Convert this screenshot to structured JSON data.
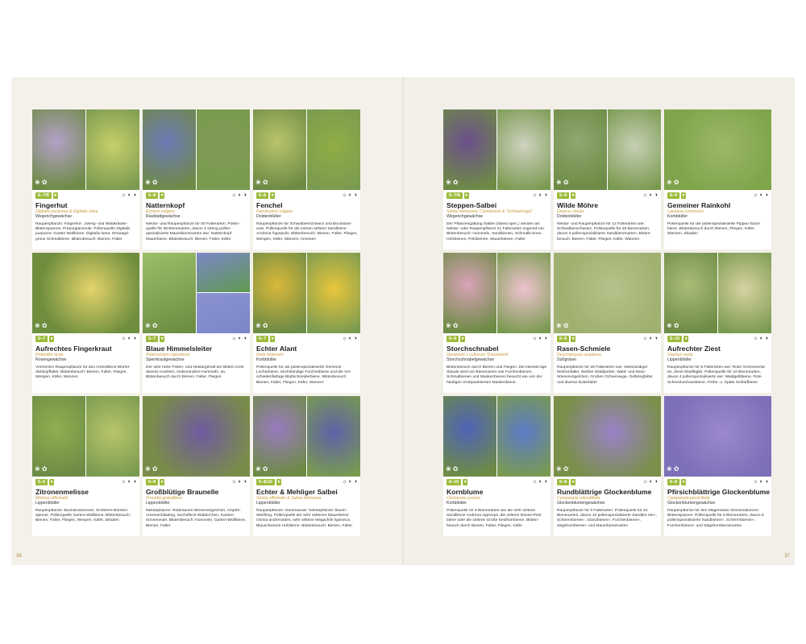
{
  "page_left_number": "36",
  "page_right_number": "37",
  "symbols": "☼ ◐ ◑",
  "left_cards": [
    {
      "months": "6–7/8",
      "name": "Fingerhut",
      "latin": "Digitalis purpurea & Digitalis lutea",
      "family": "Wegerichgewächse",
      "desc": "Raupenpflanze: Fingerhut-, Zwerg- und Waldkräuter-Blütenspanner, Purpurglanzeule. Pollenquelle Digitalis purpurea: Garten-Wollbiene. Digitalis lutea: Smaragd-grüne Schmalbiene. Blütenbesuch: Bienen, Falter",
      "colors": [
        "#b4a0c8",
        "#c7cf6a"
      ],
      "layout": "split"
    },
    {
      "months": "5–8",
      "name": "Natternkopf",
      "latin": "Echium vulgare",
      "family": "Raublattgewächse",
      "desc": "Nektar- und Raupenpflanze für 50 Falterarten. Pollen-quelle für 38 Bienenarten, davon 3 streng pollen-spezialisierte Mauerbienenarten wie: Natternkopf-Mauerbiene. Blütenbesuch: Bienen, Falter, Käfer",
      "colors": [
        "#6f78b8",
        "#7d9a55"
      ],
      "layout": "split"
    },
    {
      "months": "6–8",
      "name": "Fenchel",
      "latin": "Foeniculum vulgare",
      "family": "Doldenblütler",
      "desc": "Raupenpflanze für Schwalbenschwanz und Bocksbart-eule. Pollenquelle für die extrem seltene Sandbiene Andrena hypopolis. Blütenbesuch: Bienen, Falter, Fliegen, Wespen, Käfer, Wanzen, Ameisen",
      "colors": [
        "#b9c46a",
        "#8fae45"
      ],
      "layout": "split"
    },
    {
      "months": "6–7",
      "name": "Aufrechtes Fingerkraut",
      "latin": "Potentilla recta",
      "family": "Rosengewächse",
      "desc": "Vormerlich Raupenpflanze für den Ambollfleck-Würfel-dickkopffalter. Blütenbesuch: Bienen, Falter, Fliegen, Wespen, Käfer, Wanzen",
      "colors": [
        "#6e8e3e",
        "#e4d36a"
      ],
      "layout": "full"
    },
    {
      "months": "5–7",
      "name": "Blaue Himmelsleiter",
      "latin": "Polemonium caeruleum",
      "family": "Sperrkrautgewächse",
      "desc": "Der sehr hohe Pollen- und Nektargehalt der Blüten lockt diverse Insekten, insbesondere Hummeln, an. Blütenbesuch durch Bienen, Falter, Fliegen",
      "colors": [
        "#9cbf6a",
        "#7c86c8"
      ],
      "layout": "three"
    },
    {
      "months": "6–7",
      "name": "Echter Alant",
      "latin": "Inula helenium",
      "family": "Korbblütler",
      "desc": "Pollenquelle für die pollenspezialisierte Gemeine Löcherbiene, Sechsbindige Furchenbiene und die Ver-schiedenfarbige Blattschneiderbiene. Blütenbesuch: Bienen, Falter, Fliegen, Käfer, Wanzen",
      "colors": [
        "#d9b83a",
        "#e8c63c"
      ],
      "layout": "split"
    },
    {
      "months": "5–6",
      "name": "Zitronenmelisse",
      "latin": "Melissa officinalis",
      "family": "Lippenblütler",
      "desc": "Raupenpflanze: Buchdruckereule, Schlehen-Bürsten-spinner. Pollenquelle Garten-Wollbiene. Blütenbesuch: Bienen, Falter, Fliegen, Wespen, Käfer, Zikaden",
      "colors": [
        "#8fb050",
        "#b8c66a"
      ],
      "layout": "split"
    },
    {
      "months": "6–8",
      "name": "Großblütige Braunelle",
      "latin": "Prunella grandiflora",
      "family": "Lippenblütler",
      "desc": "Nektarpflanze: Rotbraunes Wiesenvögelchen, Ampfer-Ameisenbläuling, Sechsfleck-Widderchen, Karden-Sonneneule. Blütenbesuch: Hummeln, Garten-Wollbiene, Bienen, Falter",
      "colors": [
        "#7a8c4a",
        "#6f5aa0"
      ],
      "layout": "full"
    },
    {
      "months": "6–8/10",
      "name": "Echter & Mehliger Salbei",
      "latin": "Salvia officinalis & Salvia farinacea",
      "family": "Lippenblütler",
      "desc": "Raupenpflanze: Gammaeule. Nektarpflanze: Baum-Weißling. Pollenquelle der sehr seltenen Mauerbiene Osmia andrenoides, sehr seltene Megachile ligniseca, Blauschwarze Holzbiene. Blütenbesuch: Bienen, Falter",
      "colors": [
        "#9a7ac0",
        "#5c62a8"
      ],
      "layout": "split"
    }
  ],
  "right_cards": [
    {
      "months": "6–7/8",
      "name": "Steppen-Salbei",
      "latin": "Salvia nemorosa 'Caradonna' & 'Schneehügel'",
      "family": "Wegerichgewächse",
      "desc": "Der Pflanzengattung Salbei (Salvia spec.) werden als Nektar- oder Raupenpflanze 31 Falterarten zugeord-net. Blütenbesuch: Hummeln, Sandbienen, Schmalbi-enen, Holzbienen, Pelzbienen, Mauerbienen, Falter",
      "colors": [
        "#6d4f8c",
        "#cfd2c0"
      ],
      "layout": "split"
    },
    {
      "months": "6–9",
      "name": "Wilde Möhre",
      "latin": "Daucus carota",
      "family": "Doldenblütler",
      "desc": "Nektar- und Raupenpflanze für 12 Falterarten wie: Schwalbenschwanz. Pollenquelle für 25 Bienenarten, davon 4 pollenspezialisierte Sandbienenarten. Blüten-besuch: Bienen, Falter, Fliegen, Käfer, Wanzen",
      "colors": [
        "#8fa870",
        "#c6cfb4"
      ],
      "layout": "split"
    },
    {
      "months": "6–9",
      "name": "Gemeiner Rainkohl",
      "latin": "Lapsana communis",
      "family": "Korbblütler",
      "desc": "Pollenquelle für die pollenspezialisierte Pippau-Sand-biene. Blütenbesuch durch Bienen, Fliegen, Käfer, Wanzen, Zikaden",
      "colors": [
        "#7fa44a",
        "#9cb868"
      ],
      "layout": "full"
    },
    {
      "months": "6–9",
      "name": "Storchschnabel",
      "latin": "Geranium x cultorum 'Dreamland'",
      "family": "Storchschnabelgewächse",
      "desc": "Blütenbesuch durch Bienen und Fliegen. Die kleinblü-tige Staude wird von Bienenarten wie Furchenbienen, Schmalbienen und Maskenbienen besucht wie von der häufigen Grobpunktierten Maskenbiene.",
      "colors": [
        "#d9a3b8",
        "#eec3cf"
      ],
      "layout": "split"
    },
    {
      "months": "6–8",
      "name": "Rasen-Schmiele",
      "latin": "Deschampsia cespitosa",
      "family": "Süßgräser",
      "desc": "Raupenpflanze für 26 Falterarten wie: Weißrandiger Mohrenfalter, Weißer Waldportier, Wald- und Moor-Wiesenvögelchen, Großes Ochsenauge, Gelbringfalter und diverse Eulenfalter",
      "colors": [
        "#9fb070",
        "#b6c28a"
      ],
      "layout": "full"
    },
    {
      "months": "6–10",
      "name": "Aufrechter Ziest",
      "latin": "Stachys recta",
      "family": "Lippenblütler",
      "desc": "Raupenpflanze für 5 Falterarten wie: Roter Scheckenfal-ter, Ziest-Glasflügler. Pollenquelle für 10 Bienenarten, davon 4 pollenspezialisierte wie: Waldgelbbiene, Rote Schneckenhausbiene, Frühe- u. Späte Schlürfbiene",
      "colors": [
        "#a9bc78",
        "#d8d2a2"
      ],
      "layout": "split"
    },
    {
      "months": "6–10",
      "name": "Kornblume",
      "latin": "Centaurea cyanus",
      "family": "Korbblütler",
      "desc": "Pollenquelle für 8 Bienenarten wie die sehr seltene Sandbiene Andrena nigriceps, die seltene Dünen-Pelz-biene oder die seltene Große Keulhornbiene. Blüten-besuch durch Bienen, Falter, Fliegen, Käfer",
      "colors": [
        "#4f62b8",
        "#5c7ac8"
      ],
      "layout": "split"
    },
    {
      "months": "6–8",
      "name": "Rundblättrige Glockenblume",
      "latin": "Campanula rotundifolia",
      "family": "Glockenblumengewächse",
      "desc": "Raupenpflanze für 6 Falterarten. Pollenquelle für 24 Bienenarten, davon 10 pollenspezialisierte Sandbie-nen-, Scherenbienen-, Glanzbienen-, Furchenbienen-, Sägehornbienen- und Mauerbienenarten",
      "colors": [
        "#7a8f4a",
        "#9a82c8"
      ],
      "layout": "full"
    },
    {
      "months": "6–8",
      "name": "Pfirsichblättrige Glockenblume",
      "latin": "Campanula persicifolia",
      "family": "Glockenblumengewächse",
      "desc": "Raupenpflanze für den Magerrasen-Glockenblumen-Blütenspanner. Pollenquelle für 8 Bienenarten, davon 6 pollenspezialisierte Sandbienen-, Scherenbienen-, Furchenbienen- und Sägehornbienenarten",
      "colors": [
        "#7d6fb8",
        "#9b88cc"
      ],
      "layout": "full"
    }
  ]
}
